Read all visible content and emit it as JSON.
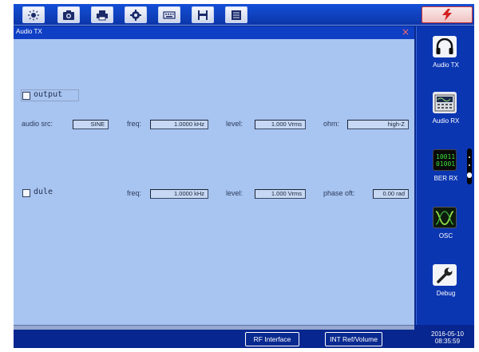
{
  "toolbar": {
    "buttons": [
      "brightness-icon",
      "camera-icon",
      "print-icon",
      "settings-icon",
      "keyboard-icon",
      "save-icon",
      "list-icon"
    ],
    "alarm_icon": "lightning-icon"
  },
  "window": {
    "title": "Audio TX",
    "close_glyph": "×"
  },
  "audio": {
    "output_label": "output",
    "src_label": "audio src:",
    "src_value": "SINE",
    "freq_label": "freq:",
    "freq_value": "1.0000 kHz",
    "level_label": "level:",
    "level_value": "1.000  Vrms",
    "ohm_label": "ohm:",
    "ohm_value": "high-Z"
  },
  "mod": {
    "dule_label": "dule",
    "freq_label": "freq:",
    "freq_value": "1.0000 kHz",
    "level_label": "level:",
    "level_value": "1.000  Vrms",
    "phase_label": "phase oft:",
    "phase_value": "0.00 rad"
  },
  "sidebar": {
    "items": [
      {
        "label": "Audio TX",
        "icon": "headphones-icon"
      },
      {
        "label": "Audio RX",
        "icon": "audio-rx-icon"
      },
      {
        "label": "BER RX",
        "icon": "binary-icon"
      },
      {
        "label": "OSC",
        "icon": "waveform-icon"
      },
      {
        "label": "Debug",
        "icon": "wrench-icon"
      }
    ]
  },
  "status": {
    "rf_interface": "RF Interface",
    "int_ref": "INT Ref/Volume",
    "date": "2016-05-10",
    "time": "08:35:59"
  },
  "colors": {
    "background": "#0a2a8c",
    "panel": "#a8c4f0",
    "titlebar": "#0f3fc4"
  }
}
